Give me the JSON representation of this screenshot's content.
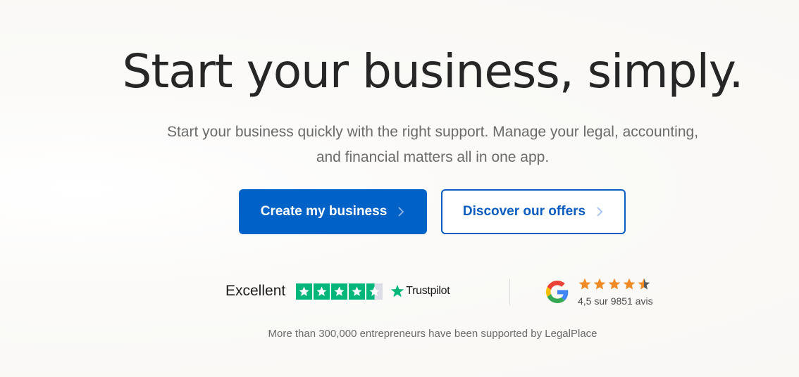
{
  "hero": {
    "title": "Start your business, simply.",
    "subtitle_line1": "Start your business quickly with the right support. Manage your legal, accounting,",
    "subtitle_line2": "and financial matters all in one app."
  },
  "actions": {
    "primary_label": "Create my business",
    "secondary_label": "Discover our offers"
  },
  "trustpilot": {
    "label": "Excellent",
    "brand": "Trustpilot",
    "rating_stars": 4.5,
    "star_icon": "star-icon"
  },
  "google": {
    "rating_text": "4,5 sur 9851 avis",
    "rating_stars": 4.5,
    "logo_icon": "google-logo-icon"
  },
  "footnote": "More than 300,000 entrepreneurs have been supported by LegalPlace",
  "colors": {
    "primary": "#0062c7",
    "trustpilot_green": "#00b67a",
    "google_star_orange": "#f08a24",
    "background": "#faf8f5"
  }
}
